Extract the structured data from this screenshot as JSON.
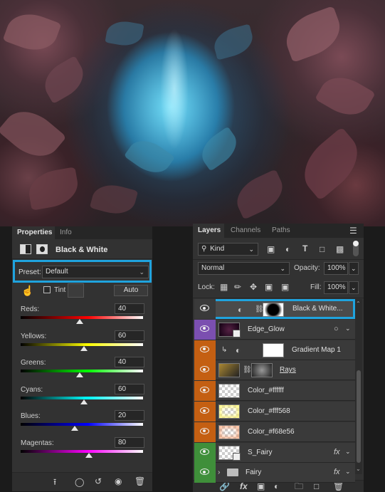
{
  "properties": {
    "tabs": [
      "Properties",
      "Info"
    ],
    "title": "Black & White",
    "preset_label": "Preset:",
    "preset_value": "Default",
    "tint_label": "Tint",
    "auto_label": "Auto",
    "sliders": [
      {
        "label": "Reds:",
        "value": "40",
        "level": 40,
        "colors": [
          "#ff0000",
          "#000000"
        ]
      },
      {
        "label": "Yellows:",
        "value": "60",
        "level": 60,
        "colors": [
          "#ffff00",
          "#000000"
        ]
      },
      {
        "label": "Greens:",
        "value": "40",
        "level": 40,
        "colors": [
          "#00ff00",
          "#000000"
        ]
      },
      {
        "label": "Cyans:",
        "value": "60",
        "level": 60,
        "colors": [
          "#00ffff",
          "#000000"
        ]
      },
      {
        "label": "Blues:",
        "value": "20",
        "level": 20,
        "colors": [
          "#0000ff",
          "#000000"
        ]
      },
      {
        "label": "Magentas:",
        "value": "80",
        "level": 80,
        "colors": [
          "#ff00ff",
          "#000000"
        ]
      }
    ]
  },
  "layers_panel": {
    "tabs": [
      "Layers",
      "Channels",
      "Paths"
    ],
    "filter_label": "Kind",
    "blend_mode": "Normal",
    "opacity_label": "Opacity:",
    "opacity_value": "100%",
    "lock_label": "Lock:",
    "fill_label": "Fill:",
    "fill_value": "100%",
    "layers": [
      {
        "name": "Black & White...",
        "color": "#3a3a3a",
        "selected": true
      },
      {
        "name": "Edge_Glow",
        "color": "#7b4fb0"
      },
      {
        "name": "Gradient Map 1",
        "color": "#c45f12"
      },
      {
        "name": "Rays",
        "color": "#c45f12"
      },
      {
        "name": "Color_#ffffff",
        "color": "#c45f12"
      },
      {
        "name": "Color_#fff568",
        "color": "#c45f12"
      },
      {
        "name": "Color_#f68e56",
        "color": "#c45f12"
      },
      {
        "name": "S_Fairy",
        "color": "#3f8f3a"
      },
      {
        "name": "Fairy",
        "color": "#3f8f3a"
      }
    ],
    "fx_label": "fx"
  },
  "highlight_color": "#1fa3de"
}
